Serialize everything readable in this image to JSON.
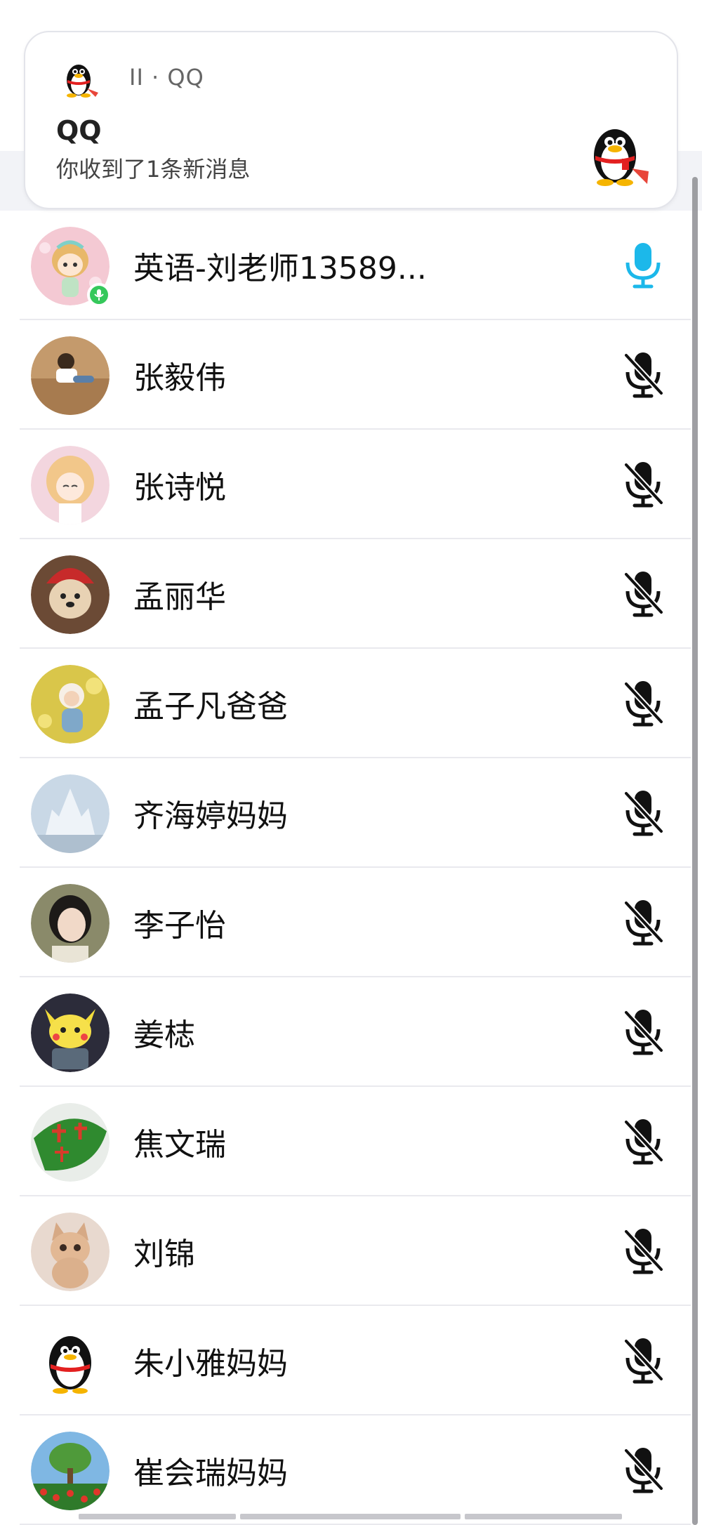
{
  "notification": {
    "meta": "II · QQ",
    "title": "QQ",
    "body": "你收到了1条新消息"
  },
  "participants": [
    {
      "name": "英语-刘老师13589...",
      "mic": "on",
      "speaking_badge": true,
      "avatar": "cartoon-girl"
    },
    {
      "name": "张毅伟",
      "mic": "muted",
      "avatar": "child-sand"
    },
    {
      "name": "张诗悦",
      "mic": "muted",
      "avatar": "anime-girl"
    },
    {
      "name": "孟丽华",
      "mic": "muted",
      "avatar": "dog-hat"
    },
    {
      "name": "孟子凡爸爸",
      "mic": "muted",
      "avatar": "baby-flowers"
    },
    {
      "name": "齐海婷妈妈",
      "mic": "muted",
      "avatar": "ice-castle"
    },
    {
      "name": "李子怡",
      "mic": "muted",
      "avatar": "girl-portrait"
    },
    {
      "name": "姜梽",
      "mic": "muted",
      "avatar": "pikachu"
    },
    {
      "name": "焦文瑞",
      "mic": "muted",
      "avatar": "green-leaf-text"
    },
    {
      "name": "刘锦",
      "mic": "muted",
      "avatar": "kitten"
    },
    {
      "name": "朱小雅妈妈",
      "mic": "muted",
      "avatar": "qq-penguin"
    },
    {
      "name": "崔会瑞妈妈",
      "mic": "muted",
      "avatar": "tree-poppies"
    }
  ],
  "colors": {
    "mic_on": "#1cb8ea",
    "mic_muted": "#111111",
    "badge": "#35c85b"
  }
}
